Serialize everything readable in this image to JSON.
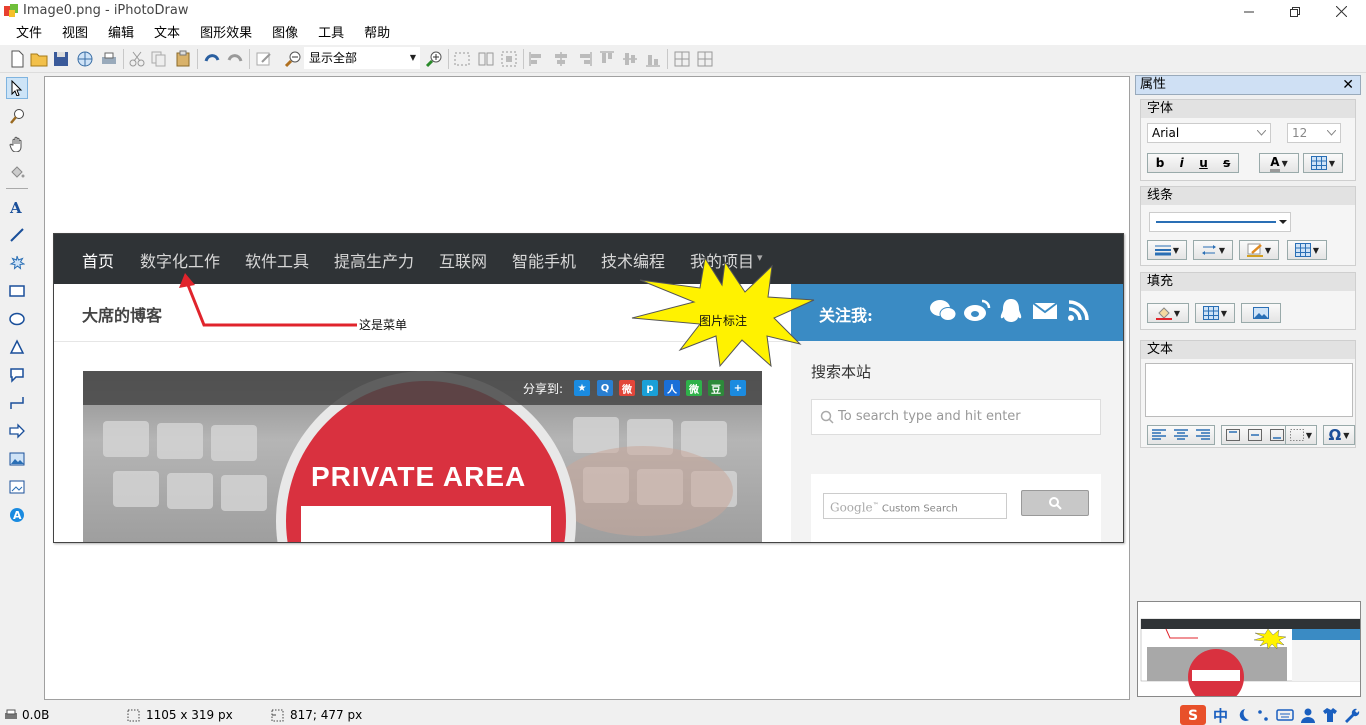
{
  "window": {
    "title": "Image0.png - iPhotoDraw"
  },
  "menu": [
    "文件",
    "视图",
    "编辑",
    "文本",
    "图形效果",
    "图像",
    "工具",
    "帮助"
  ],
  "toolbar": {
    "zoom_value": "显示全部"
  },
  "site": {
    "nav": [
      "首页",
      "数字化工作",
      "软件工具",
      "提高生产力",
      "互联网",
      "智能手机",
      "技术编程",
      "我的项目"
    ],
    "nav_dropdown_marker": "▾",
    "blog_title": "大席的博客",
    "follow_label": "关注我:",
    "share_label": "分享到:",
    "share_icons": [
      {
        "glyph": "★",
        "color": "#1a8be0"
      },
      {
        "glyph": "Q",
        "color": "#2a7fd0"
      },
      {
        "glyph": "微",
        "color": "#e2463a"
      },
      {
        "glyph": "p",
        "color": "#1aa0d8"
      },
      {
        "glyph": "人",
        "color": "#1a6fd8"
      },
      {
        "glyph": "微",
        "color": "#2eb24a"
      },
      {
        "glyph": "豆",
        "color": "#2d8a3a"
      },
      {
        "glyph": "+",
        "color": "#1b8be0"
      }
    ],
    "sign_text": "PRIVATE AREA",
    "search_title": "搜索本站",
    "search_placeholder": "To search type and hit enter",
    "gcse_logo": "Google",
    "gcse_tm": "™",
    "gcse_text": "Custom Search",
    "accent": "#3a8bc4"
  },
  "annotations": {
    "menu_callout": "这是菜单",
    "image_callout": "图片标注"
  },
  "panel": {
    "title": "属性",
    "close": "✕",
    "font_group": "字体",
    "font_name": "Arial",
    "font_size": "12",
    "line_group": "线条",
    "fill_group": "填充",
    "text_group": "文本",
    "omega": "Ω"
  },
  "status": {
    "file_size": "0.0B",
    "image_size": "1105 x 319 px",
    "cursor": "817; 477 px"
  }
}
